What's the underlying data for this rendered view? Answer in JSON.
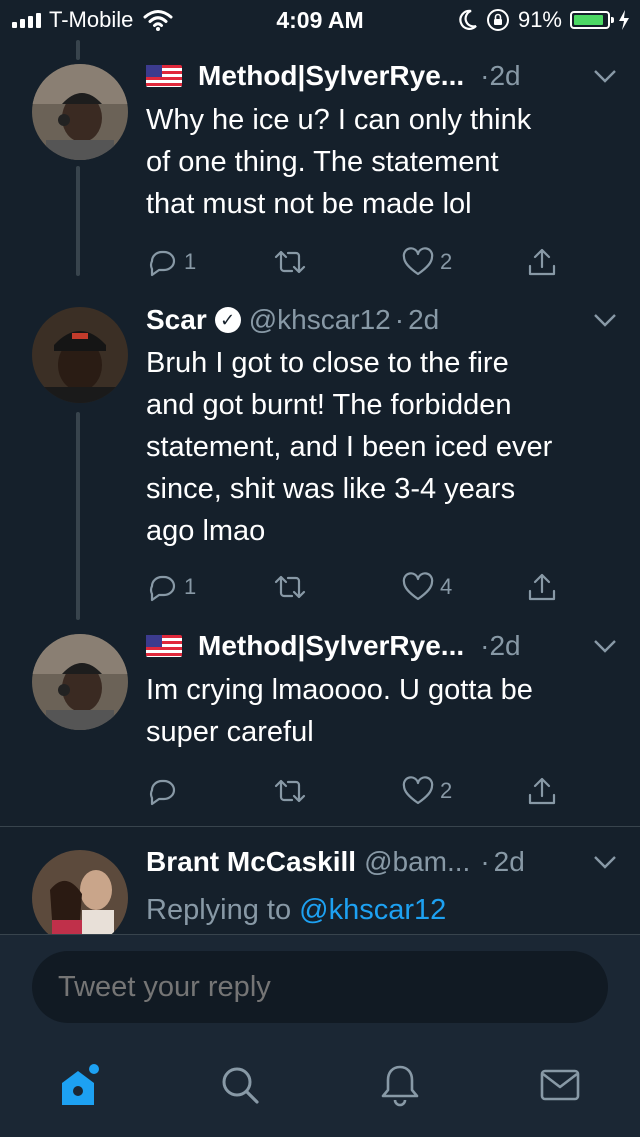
{
  "status": {
    "carrier": "T-Mobile",
    "time": "4:09 AM",
    "battery": "91%",
    "battery_level": 0.91
  },
  "tweets": [
    {
      "name": "Method|SylverRye...",
      "separator": "·",
      "time": "2d",
      "text_lines": [
        "Why he ice u? I can only think",
        "of one thing.  The statement",
        "that must not be made lol"
      ],
      "replies": "1",
      "retweets": "",
      "likes": "2"
    },
    {
      "name": "Scar",
      "handle": "@khscar12",
      "separator": "·",
      "time": "2d",
      "verified_mark": "✓",
      "text_lines": [
        "Bruh I got to close to the fire",
        "and got burnt! The forbidden",
        "statement, and I been iced ever",
        "since, shit was like 3-4 years",
        "ago lmao"
      ],
      "replies": "1",
      "retweets": "",
      "likes": "4"
    },
    {
      "name": "Method|SylverRye...",
      "separator": "·",
      "time": "2d",
      "text_lines": [
        "Im crying lmaoooo.  U gotta be",
        "super careful"
      ],
      "replies": "",
      "retweets": "",
      "likes": "2"
    },
    {
      "name": "Brant McCaskill",
      "handle": "@bam...",
      "separator": "·",
      "time": "2d",
      "replying_prefix": "Replying to",
      "replying_handle": "@khscar12"
    }
  ],
  "reply_bar": {
    "placeholder": "Tweet your reply"
  },
  "tabs": [
    "home-icon",
    "search-icon",
    "bell-icon",
    "mail-icon"
  ],
  "colors": {
    "background": "#15202b",
    "accent": "#1da1f2",
    "muted": "#8899a6",
    "battery": "#4cd964"
  }
}
